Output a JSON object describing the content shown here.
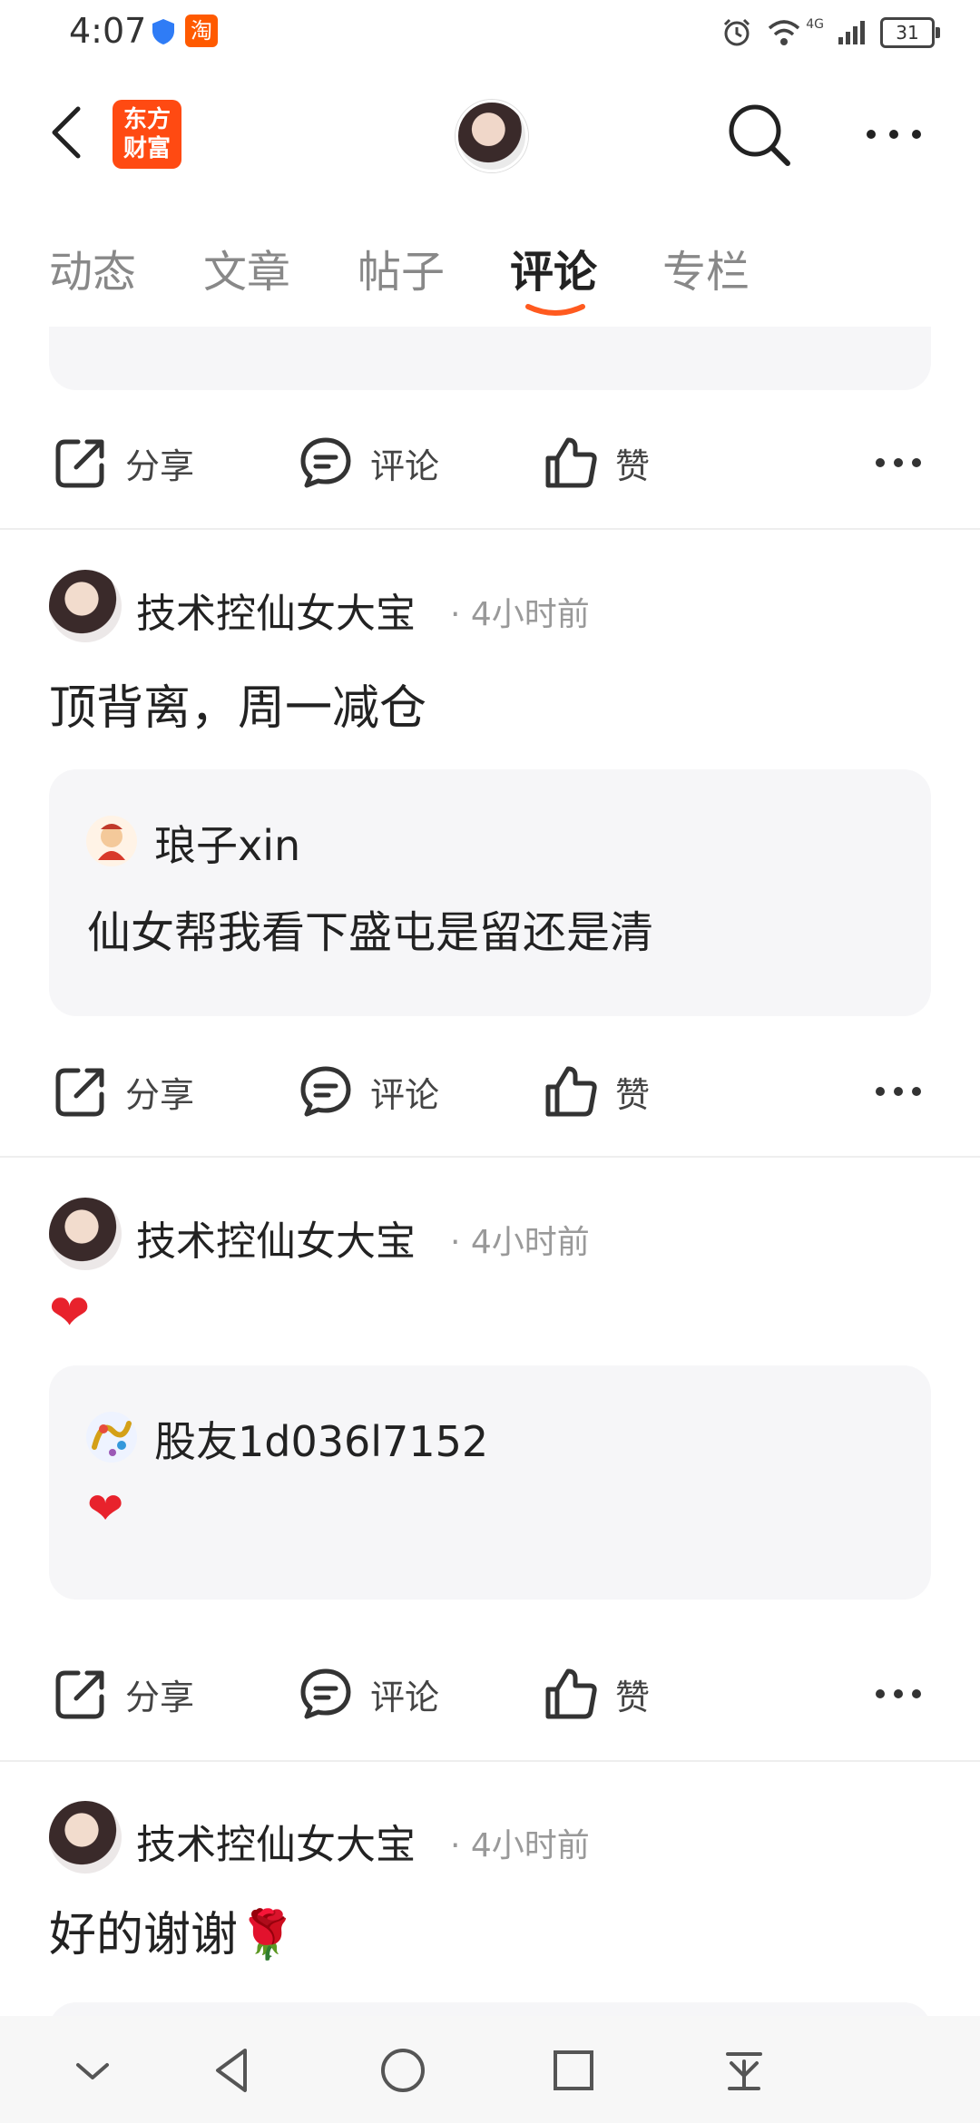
{
  "status_bar": {
    "time": "4:07",
    "network": "4G",
    "battery": "31"
  },
  "header": {
    "logo_text_line1": "东方",
    "logo_text_line2": "财富"
  },
  "tabs": [
    {
      "label": "动态"
    },
    {
      "label": "文章"
    },
    {
      "label": "帖子"
    },
    {
      "label": "评论",
      "active": true
    },
    {
      "label": "专栏"
    }
  ],
  "actions": {
    "share": "分享",
    "comment": "评论",
    "like": "赞"
  },
  "posts": [
    {
      "author": "技术控仙女大宝",
      "time": "· 4小时前",
      "text": "顶背离，周一减仓",
      "quote": {
        "author": "琅子xin",
        "text": "仙女帮我看下盛屯是留还是清"
      }
    },
    {
      "author": "技术控仙女大宝",
      "time": "· 4小时前",
      "text": "❤",
      "quote": {
        "author": "股友1d036l7152",
        "text": "❤"
      }
    },
    {
      "author": "技术控仙女大宝",
      "time": "· 4小时前",
      "text": "好的谢谢🌹"
    }
  ],
  "colors": {
    "accent": "#ff5a1f",
    "card_bg": "#f6f6f8",
    "muted_text": "#999999"
  }
}
